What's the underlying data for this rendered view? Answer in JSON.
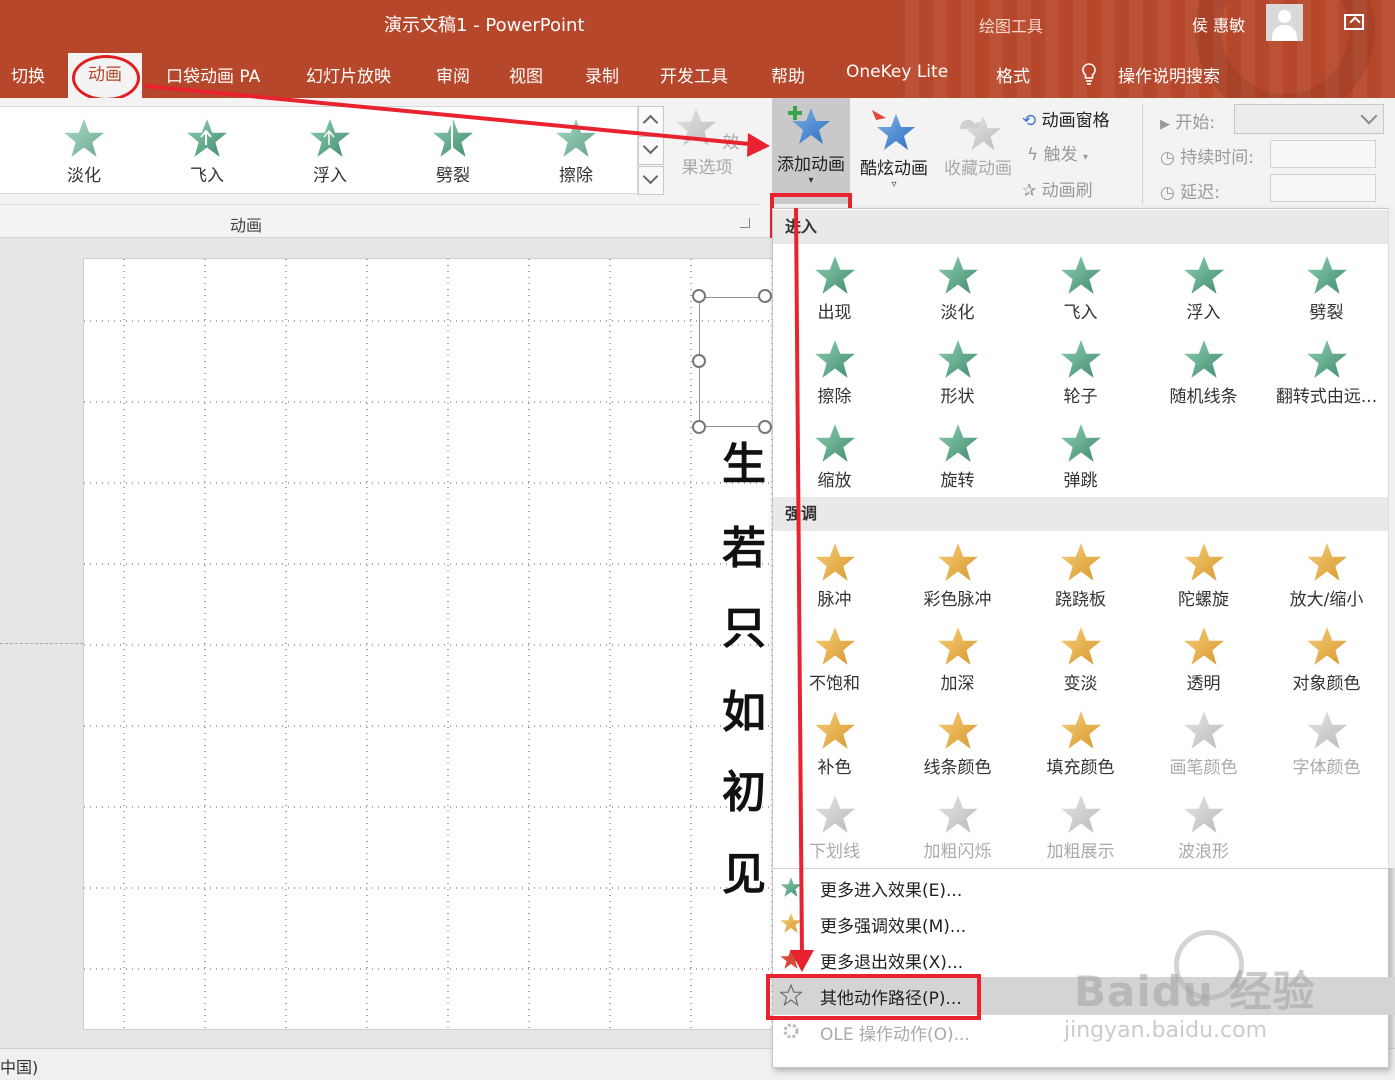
{
  "window": {
    "title": "演示文稿1  -  PowerPoint",
    "context_tab": "绘图工具",
    "user_name": "侯 惠敏"
  },
  "tabs": [
    {
      "label": "切换"
    },
    {
      "label": "动画"
    },
    {
      "label": "口袋动画 PA"
    },
    {
      "label": "幻灯片放映"
    },
    {
      "label": "审阅"
    },
    {
      "label": "视图"
    },
    {
      "label": "录制"
    },
    {
      "label": "开发工具"
    },
    {
      "label": "帮助"
    },
    {
      "label": "OneKey Lite"
    },
    {
      "label": "格式"
    },
    {
      "label": "操作说明搜索"
    }
  ],
  "ribbon": {
    "gallery": [
      "淡化",
      "飞入",
      "浮入",
      "劈裂",
      "擦除"
    ],
    "effect_options": "效果选项",
    "group_label": "动画",
    "add_animation": "添加动画",
    "cool_animation": "酷炫动画",
    "favorite_animation": "收藏动画",
    "animation_pane": "动画窗格",
    "trigger": "触发",
    "animation_painter": "动画刷",
    "start_label": "开始:",
    "duration_label": "持续时间:",
    "delay_label": "延迟:"
  },
  "slide": {
    "vertical_text": [
      "生",
      "若",
      "只",
      "如",
      "初",
      "见"
    ]
  },
  "dropdown": {
    "entrance_header": "进入",
    "entrance": [
      "出现",
      "淡化",
      "飞入",
      "浮入",
      "劈裂",
      "擦除",
      "形状",
      "轮子",
      "随机线条",
      "翻转式由远...",
      "缩放",
      "旋转",
      "弹跳"
    ],
    "emphasis_header": "强调",
    "emphasis": [
      "脉冲",
      "彩色脉冲",
      "跷跷板",
      "陀螺旋",
      "放大/缩小",
      "不饱和",
      "加深",
      "变淡",
      "透明",
      "对象颜色",
      "补色",
      "线条颜色",
      "填充颜色",
      "画笔颜色",
      "字体颜色",
      "下划线",
      "加粗闪烁",
      "加粗展示",
      "波浪形"
    ],
    "more": [
      {
        "label": "更多进入效果(E)...",
        "enabled": true
      },
      {
        "label": "更多强调效果(M)...",
        "enabled": true
      },
      {
        "label": "更多退出效果(X)...",
        "enabled": true
      },
      {
        "label": "其他动作路径(P)...",
        "enabled": true
      },
      {
        "label": "OLE 操作动作(O)...",
        "enabled": false
      }
    ]
  },
  "status": {
    "language": "中国)"
  },
  "watermark": {
    "main": "Baidu 经验",
    "sub": "jingyan.baidu.com"
  },
  "colors": {
    "accent": "#b7472a",
    "entrance_green": "#5a9e84",
    "emphasis_gold": "#e8b04a",
    "highlight_red": "#e8232f"
  }
}
